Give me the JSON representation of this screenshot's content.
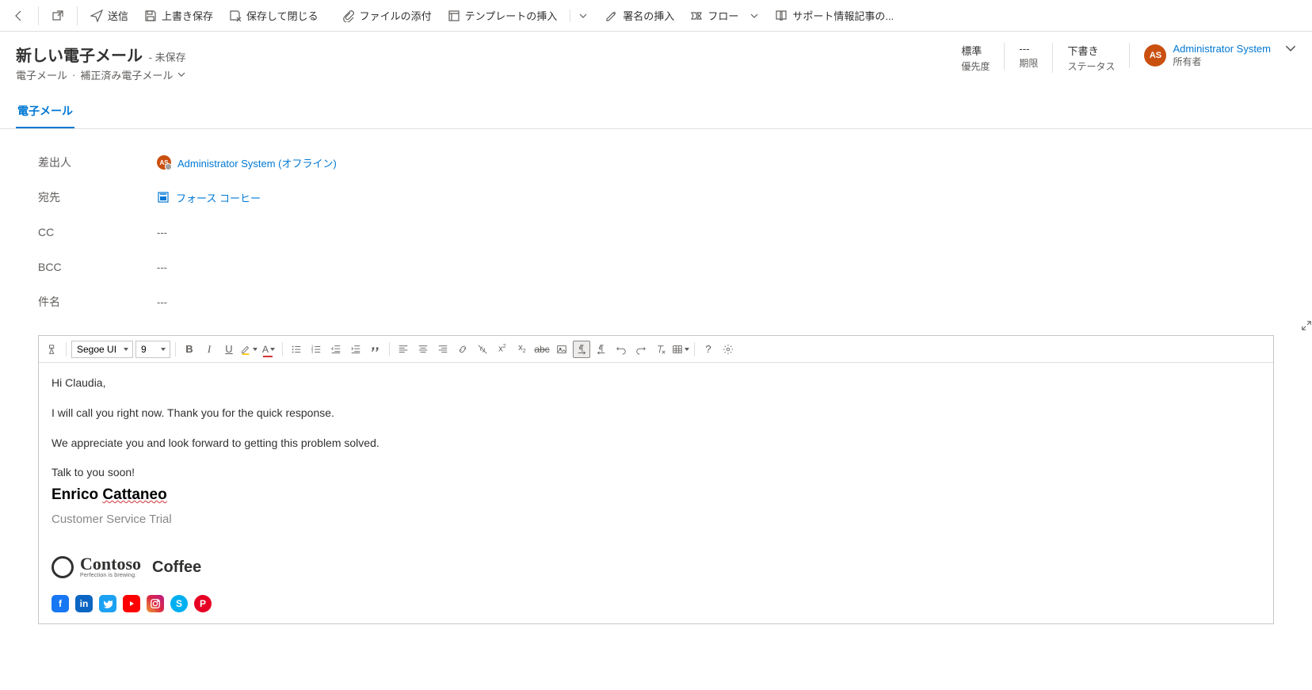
{
  "toolbar": {
    "send": "送信",
    "save": "上書き保存",
    "save_close": "保存して閉じる",
    "attach": "ファイルの添付",
    "template": "テンプレートの挿入",
    "signature": "署名の挿入",
    "flow": "フロー",
    "kb": "サポート情報記事の..."
  },
  "header": {
    "title": "新しい電子メール",
    "status": "- 未保存",
    "entity": "電子メール",
    "sub": "補正済み電子メール",
    "meta": {
      "priority_val": "標準",
      "priority_lbl": "優先度",
      "due_val": "---",
      "due_lbl": "期限",
      "status_val": "下書き",
      "status_lbl": "ステータス"
    },
    "owner": {
      "initials": "AS",
      "name": "Administrator System",
      "lbl": "所有者"
    }
  },
  "tabs": {
    "email": "電子メール"
  },
  "form": {
    "from_lbl": "差出人",
    "from_val": "Administrator System (オフライン)",
    "from_initials": "AS",
    "to_lbl": "宛先",
    "to_val": "フォース コーヒー",
    "cc_lbl": "CC",
    "cc_val": "---",
    "bcc_lbl": "BCC",
    "bcc_val": "---",
    "subject_lbl": "件名",
    "subject_val": "---"
  },
  "editor": {
    "font": "Segoe UI",
    "size": "9",
    "body": {
      "greeting": "Hi Claudia,",
      "p1": "I will call you right now. Thank you for the quick response.",
      "p2": "We appreciate you and look forward to getting this problem solved.",
      "p3": "Talk to you soon!",
      "sig_first": "Enrico ",
      "sig_last": "Cattaneo",
      "sig_title": "Customer Service Trial",
      "brand_script": "Contoso",
      "brand_tag": "Perfection is brewing.",
      "brand_coffee": "Coffee"
    }
  },
  "socials": {
    "fb": "f",
    "li": "in",
    "tw": "t",
    "yt": "▸",
    "ig": "◉",
    "sk": "S",
    "pn": "P"
  }
}
